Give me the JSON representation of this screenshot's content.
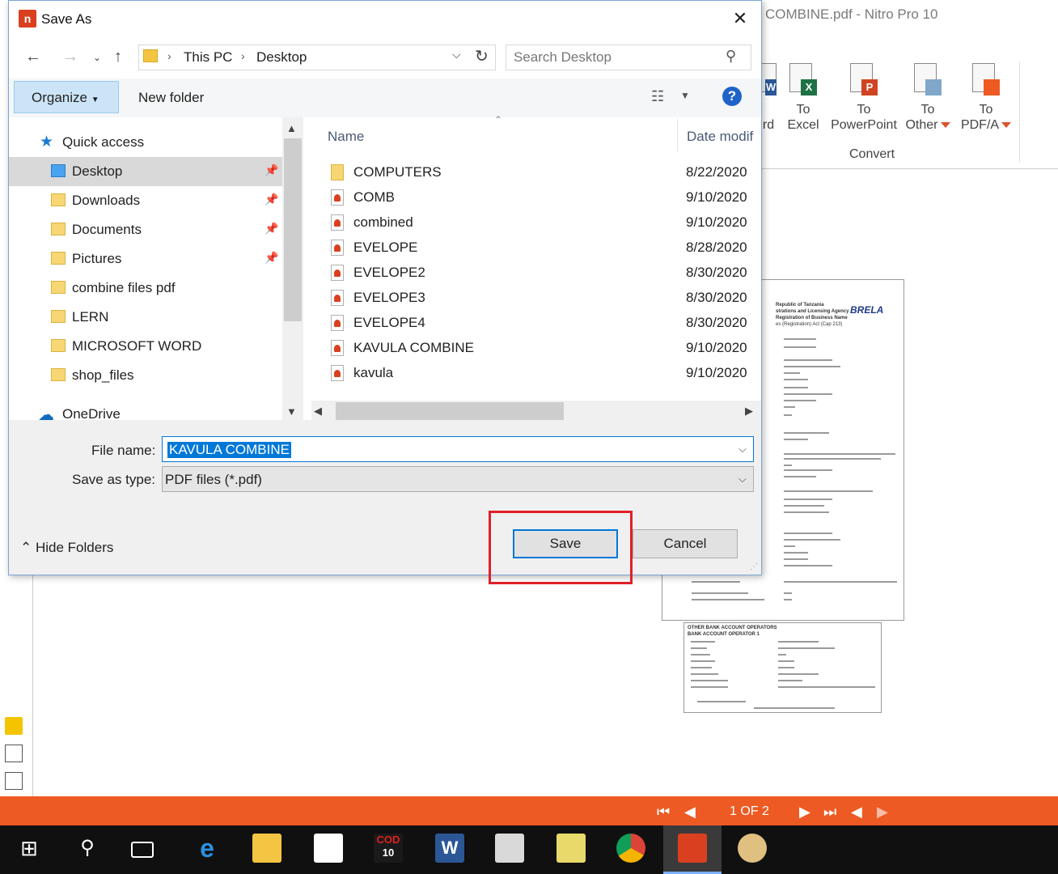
{
  "background_app": {
    "title": "COMBINE.pdf - Nitro Pro 10",
    "ribbon": {
      "buttons": [
        {
          "label_line1": "To",
          "label_line2": "Excel"
        },
        {
          "label_line1": "To",
          "label_line2": "PowerPoint"
        },
        {
          "label_line1": "To",
          "label_line2": "Other"
        },
        {
          "label_line1": "To",
          "label_line2": "PDF/A"
        }
      ],
      "partial_word_label": "rd",
      "group_label": "Convert"
    },
    "status_bar": {
      "page_indicator": "1 OF 2"
    },
    "accent_color": "#ee5a24"
  },
  "dialog": {
    "title": "Save As",
    "address": {
      "crumb1": "This PC",
      "crumb2": "Desktop"
    },
    "search_placeholder": "Search Desktop",
    "toolbar": {
      "organize_label": "Organize",
      "new_folder_label": "New folder",
      "help_label": "?"
    },
    "nav_pane": {
      "quick_access": "Quick access",
      "items": [
        {
          "label": "Desktop",
          "pinned": true
        },
        {
          "label": "Downloads",
          "pinned": true
        },
        {
          "label": "Documents",
          "pinned": true
        },
        {
          "label": "Pictures",
          "pinned": true
        },
        {
          "label": "combine files pdf",
          "pinned": false
        },
        {
          "label": "LERN",
          "pinned": false
        },
        {
          "label": "MICROSOFT WORD",
          "pinned": false
        },
        {
          "label": "shop_files",
          "pinned": false
        }
      ],
      "onedrive": "OneDrive"
    },
    "file_list": {
      "columns": {
        "name": "Name",
        "date": "Date modif"
      },
      "rows": [
        {
          "name": "COMPUTERS",
          "date": "8/22/2020",
          "type": "folder"
        },
        {
          "name": "COMB",
          "date": "9/10/2020",
          "type": "pdf"
        },
        {
          "name": "combined",
          "date": "9/10/2020",
          "type": "pdf"
        },
        {
          "name": "EVELOPE",
          "date": "8/28/2020",
          "type": "pdf"
        },
        {
          "name": "EVELOPE2",
          "date": "8/30/2020",
          "type": "pdf"
        },
        {
          "name": "EVELOPE3",
          "date": "8/30/2020",
          "type": "pdf"
        },
        {
          "name": "EVELOPE4",
          "date": "8/30/2020",
          "type": "pdf"
        },
        {
          "name": "KAVULA COMBINE",
          "date": "9/10/2020",
          "type": "pdf"
        },
        {
          "name": "kavula",
          "date": "9/10/2020",
          "type": "pdf"
        }
      ]
    },
    "form": {
      "file_name_label": "File name:",
      "file_name_value": "KAVULA COMBINE",
      "save_type_label": "Save as type:",
      "save_type_value": "PDF files (*.pdf)"
    },
    "hide_folders_label": "Hide Folders",
    "save_label": "Save",
    "cancel_label": "Cancel"
  },
  "document_preview": {
    "page1_text": [
      "Republic of Tanzania",
      "strations and Licensing Agency",
      "Registration of Business Name",
      "es (Registration) Act (Cap 213)",
      "BRELA"
    ],
    "page2_text": [
      "OTHER BANK ACCOUNT OPERATORS",
      "BANK ACCOUNT OPERATOR 1"
    ]
  },
  "taskbar": {
    "cod_label": "COD",
    "cod_sub": "10"
  }
}
